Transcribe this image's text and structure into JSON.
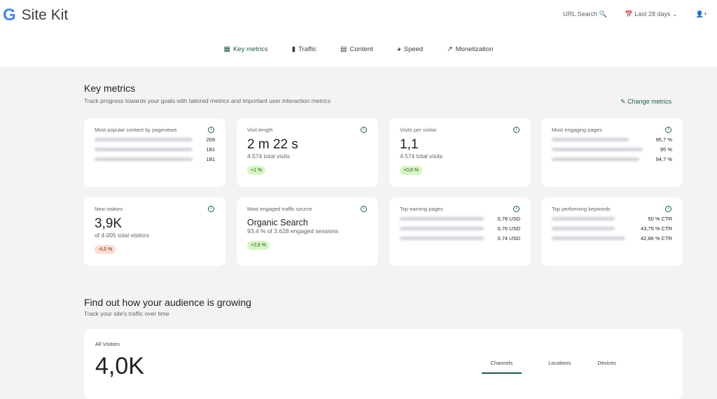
{
  "header": {
    "app_title": "Site Kit",
    "url_search": "URL Search",
    "date_range": "Last 28 days"
  },
  "nav": [
    {
      "label": "Key metrics",
      "icon": "grid-icon"
    },
    {
      "label": "Traffic",
      "icon": "bar-chart-icon"
    },
    {
      "label": "Content",
      "icon": "content-icon"
    },
    {
      "label": "Speed",
      "icon": "speedometer-icon"
    },
    {
      "label": "Monetization",
      "icon": "trending-up-icon"
    }
  ],
  "key_metrics": {
    "title": "Key metrics",
    "subtitle": "Track progress towards your goals with tailored metrics and important user interaction metrics",
    "change": "Change metrics",
    "cards": [
      {
        "title": "Most popular content by pageviews",
        "rows": [
          "209",
          "181",
          "181"
        ]
      },
      {
        "title": "Visit length",
        "value": "2 m 22 s",
        "sub": "4.574 total visits",
        "change": "+1 %"
      },
      {
        "title": "Visits per visitor",
        "value": "1,1",
        "sub": "4.574 total visits",
        "change": "+0,8 %"
      },
      {
        "title": "Most engaging pages",
        "rows": [
          "95,7 %",
          "95 %",
          "94,7 %"
        ]
      },
      {
        "title": "New visitors",
        "value": "3,9K",
        "sub": "of 4.005 total visitors",
        "change": "-4,5 %"
      },
      {
        "title": "Most engaged traffic source",
        "value": "Organic Search",
        "sub": "93,4 % of 3.628 engaged sessions",
        "change": "+2,6 %"
      },
      {
        "title": "Top earning pages",
        "rows": [
          "0,78 USD",
          "0,76 USD",
          "0.74 USD"
        ]
      },
      {
        "title": "Top performing keywords",
        "rows": [
          "50 % CTR",
          "43,75 % CTR",
          "42,86 % CTR"
        ]
      }
    ]
  },
  "audience": {
    "title": "Find out how your audience is growing",
    "subtitle": "Track your site's traffic over time",
    "card_title": "All Visitors",
    "value": "4,0K",
    "tabs": [
      "Channels",
      "Locations",
      "Devices"
    ]
  }
}
